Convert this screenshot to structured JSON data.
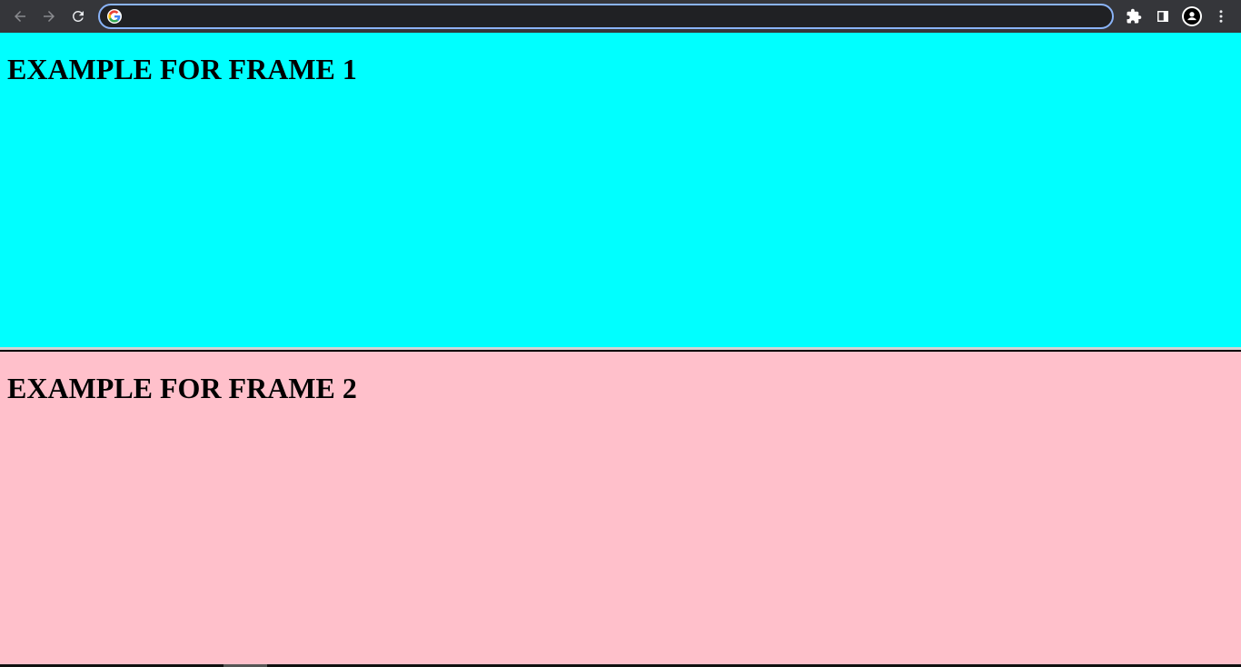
{
  "browser": {
    "address_bar": {
      "value": "",
      "placeholder": ""
    },
    "icons": {
      "back": "arrow-left-icon",
      "forward": "arrow-right-icon",
      "reload": "reload-icon",
      "site": "google-icon",
      "extensions": "puzzle-icon",
      "side_panel": "side-panel-icon",
      "profile": "profile-icon",
      "menu": "kebab-menu-icon"
    },
    "colors": {
      "toolbar": "#35363a",
      "focus_ring": "#8ab4f8"
    }
  },
  "frames": [
    {
      "heading": "EXAMPLE FOR FRAME 1",
      "background": "#00ffff"
    },
    {
      "heading": "EXAMPLE FOR FRAME 2",
      "background": "#ffc0cb"
    }
  ]
}
